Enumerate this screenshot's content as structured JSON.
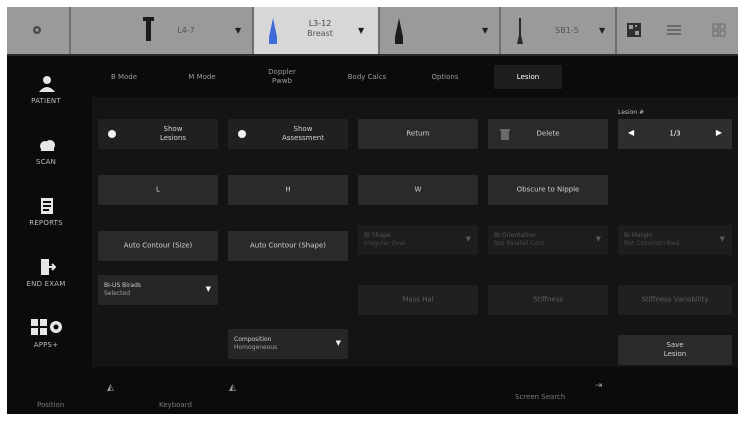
{
  "top_bar": {
    "segments": [
      {
        "name": "settings",
        "icon": "gear-icon"
      },
      {
        "name": "probe-1",
        "label": "L4-7",
        "icon": "probe-linear-icon"
      },
      {
        "name": "probe-2",
        "label": "L3-12",
        "sublabel": "Breast",
        "icon": "probe-linear-blue-icon",
        "active": true
      },
      {
        "name": "probe-3",
        "label": "",
        "icon": "probe-convex-icon"
      },
      {
        "name": "probe-4",
        "label": "SB1-5",
        "icon": "probe-hockey-icon"
      }
    ],
    "right_icons": [
      "qr-code-icon",
      "list-icon",
      "grid-icon"
    ]
  },
  "sidebar": {
    "items": [
      {
        "label": "PATIENT",
        "icon": "person-icon"
      },
      {
        "label": "SCAN",
        "icon": "cloud-icon"
      },
      {
        "label": "REPORTS",
        "icon": "report-icon"
      },
      {
        "label": "END EXAM",
        "icon": "exit-icon"
      },
      {
        "label": "APPS+",
        "icon": "apps-gear-icon"
      }
    ]
  },
  "tabs": [
    {
      "label": "B Mode",
      "active": false
    },
    {
      "label": "M Mode",
      "active": false
    },
    {
      "label": "Doppler",
      "label2": "Pwwb",
      "active": false
    },
    {
      "label": "Body Calcs",
      "active": false
    },
    {
      "label": "Options",
      "active": false
    },
    {
      "label": "Lesion",
      "active": true
    }
  ],
  "main": {
    "lesion_label": "Lesion #",
    "lesion_value": "1/3",
    "row1": {
      "show_lesions": {
        "line1": "Show",
        "line2": "Lesions"
      },
      "show_assessment": {
        "line1": "Show",
        "line2": "Assessment"
      },
      "return": "Return",
      "delete": "Delete"
    },
    "row2": {
      "a": "L",
      "b": "H",
      "c": "W",
      "obscure": "Obscure to Nipple"
    },
    "row3": {
      "auto_contour_size": "Auto Contour (Size)",
      "auto_contour_shape": "Auto Contour (Shape)",
      "dd1": {
        "label": "BI Shape",
        "value": "Irregular Oval"
      },
      "dd2": {
        "label": "BI Orientation",
        "value": "Not Parallel Cont."
      },
      "dd3": {
        "label": "BI Margin",
        "value": "Not Circumscribed"
      }
    },
    "row4": {
      "birads": {
        "label": "BI-US Birads",
        "value": "Selected"
      },
      "btn_a": "Mass Hal",
      "btn_b": "Stiffness",
      "btn_c": "Stiffness Variability"
    },
    "row5": {
      "composition": {
        "label": "Composition",
        "value": "Homogeneous"
      },
      "save_lesion": {
        "line1": "Save",
        "line2": "Lesion"
      }
    }
  },
  "bottom_bar": {
    "left_label": "Position",
    "mid_label": "Keyboard",
    "right_label": "Screen Search"
  }
}
